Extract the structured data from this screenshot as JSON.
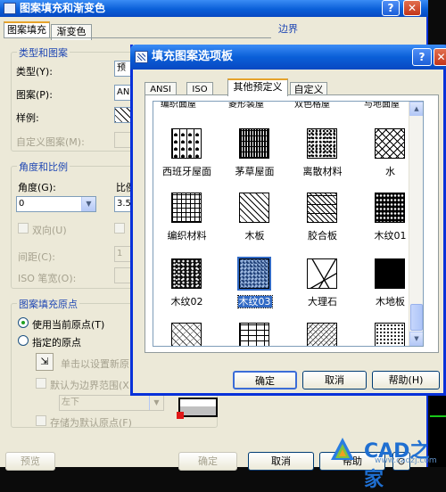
{
  "back_dialog": {
    "title": "图案填充和渐变色",
    "help_btn": "?",
    "close_btn": "✕",
    "tabs": [
      "图案填充",
      "渐变色"
    ],
    "section_type": "类型和图案",
    "type_label": "类型(Y):",
    "type_value": "预",
    "pattern_label": "图案(P):",
    "pattern_value": "AN",
    "sample_label": "样例:",
    "custom_label": "自定义图案(M):",
    "section_angle": "角度和比例",
    "angle_label": "角度(G):",
    "angle_value": "0",
    "scale_label": "比例",
    "scale_value": "3.5",
    "double_label": "双向(U)",
    "spacing_label": "间距(C):",
    "spacing_value": "1",
    "iso_label": "ISO 笔宽(O):",
    "section_origin": "图案填充原点",
    "use_current_label": "使用当前原点(T)",
    "specified_label": "指定的原点",
    "click_set_label": "单击以设置新原",
    "default_extent_label": "默认为边界范围(X",
    "extent_value": "左下",
    "store_default_label": "存储为默认原点(F)",
    "boundary_label": "边界",
    "preview_btn": "预览",
    "ok_btn": "确定",
    "cancel_btn": "取消",
    "help_btn_bottom": "帮助",
    "more_btn": "⊙"
  },
  "front_dialog": {
    "title": "填充图案选项板",
    "help_btn": "?",
    "close_btn": "✕",
    "tabs": [
      "ANSI",
      "ISO",
      "其他预定义",
      "自定义"
    ],
    "active_tab": "其他预定义",
    "top_row_labels": [
      "编织面屋",
      "菱形装屋",
      "双色格屋",
      "与地面屋"
    ],
    "patterns": [
      {
        "label": "西班牙屋面",
        "icon": "spanish-roof-pattern"
      },
      {
        "label": "茅草屋面",
        "icon": "thatch-roof-pattern"
      },
      {
        "label": "离散材料",
        "icon": "gravel-pattern"
      },
      {
        "label": "水",
        "icon": "water-pattern"
      },
      {
        "label": "编织材料",
        "icon": "weave-pattern"
      },
      {
        "label": "木板",
        "icon": "board-pattern"
      },
      {
        "label": "胶合板",
        "icon": "plywood-pattern"
      },
      {
        "label": "木纹01",
        "icon": "wood-grain-01-pattern"
      },
      {
        "label": "木纹02",
        "icon": "wood-grain-02-pattern"
      },
      {
        "label": "木纹03",
        "icon": "wood-grain-03-pattern",
        "selected": true
      },
      {
        "label": "大理石",
        "icon": "marble-pattern"
      },
      {
        "label": "木地板",
        "icon": "wood-floor-pattern"
      }
    ],
    "ok_btn": "确定",
    "cancel_btn": "取消",
    "help_btn_bottom": "帮助(H)"
  },
  "watermark": {
    "text": "CAD之家",
    "url": "www.cadzj.com"
  }
}
